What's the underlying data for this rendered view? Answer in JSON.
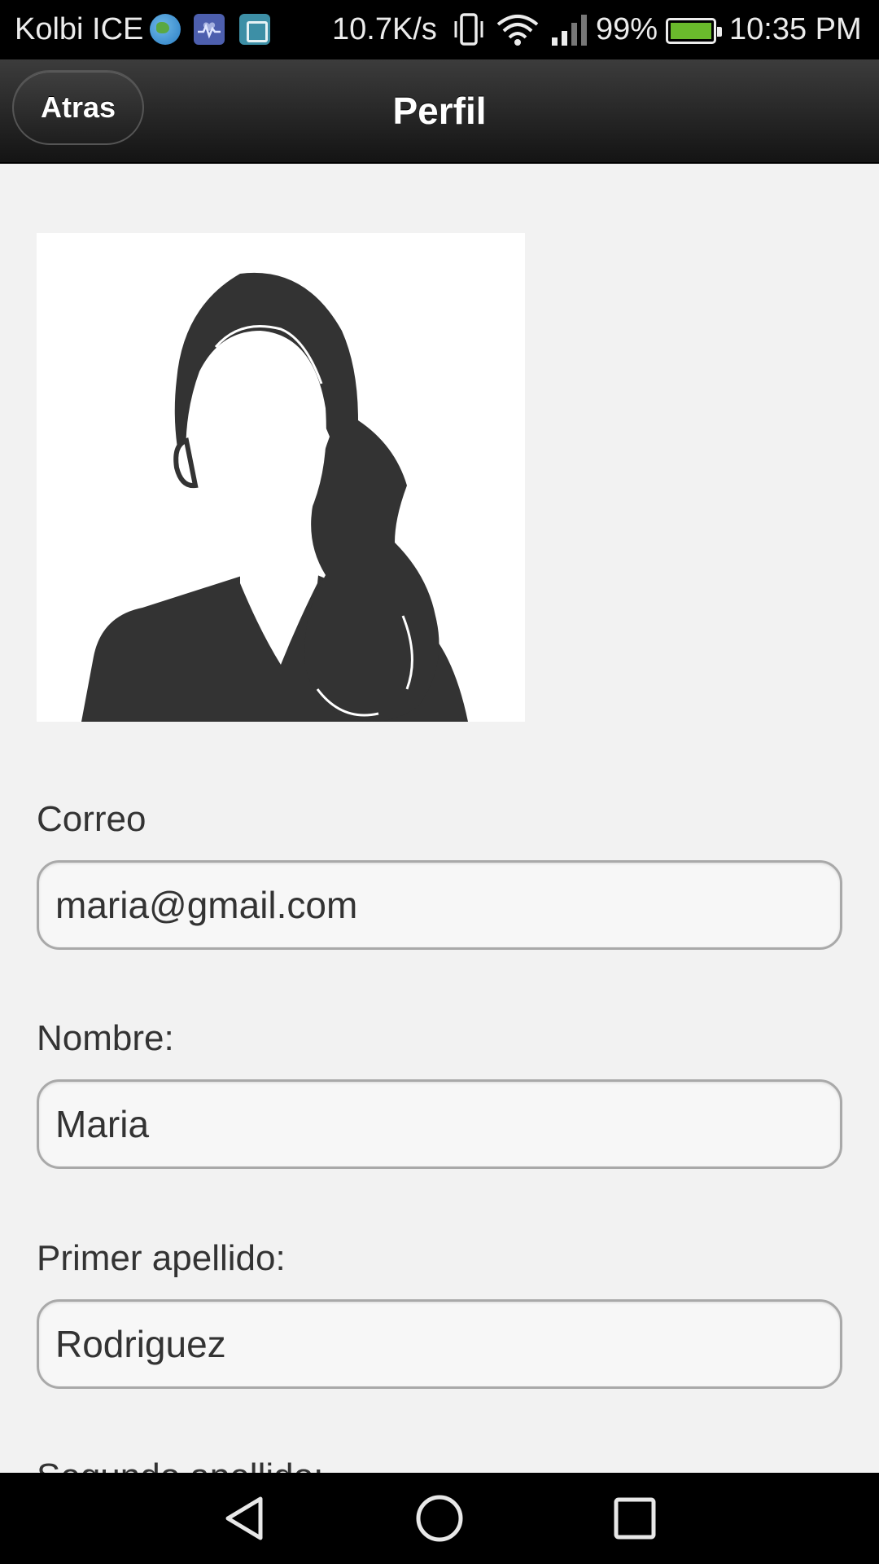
{
  "status_bar": {
    "carrier": "Kolbi ICE",
    "notifications": [
      "globe-icon",
      "health-app-icon",
      "gallery-icon"
    ],
    "net_speed": "10.7K/s",
    "battery_percent": "99%",
    "time": "10:35 PM",
    "battery_color": "#6aba2c"
  },
  "header": {
    "back_label": "Atras",
    "title": "Perfil"
  },
  "profile": {
    "avatar": "female-avatar-silhouette"
  },
  "form": {
    "email_label": "Correo",
    "email_value": "maria@gmail.com",
    "name_label": "Nombre:",
    "name_value": "Maria",
    "surname1_label": "Primer apellido:",
    "surname1_value": "Rodriguez",
    "surname2_label": "Segundo apellido:"
  },
  "nav_bar": {
    "buttons": [
      "back-triangle-icon",
      "home-circle-icon",
      "recents-square-icon"
    ]
  }
}
